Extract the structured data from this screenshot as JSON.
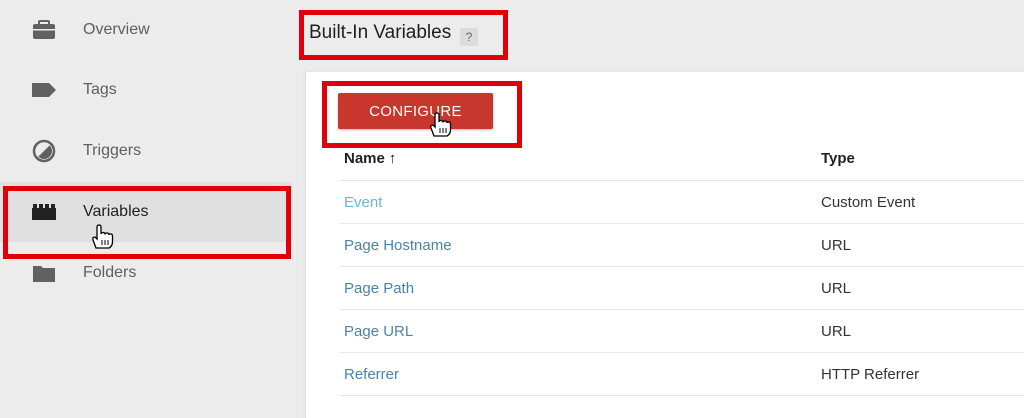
{
  "sidebar": {
    "items": [
      {
        "label": "Overview",
        "icon": "briefcase-icon"
      },
      {
        "label": "Tags",
        "icon": "tag-icon"
      },
      {
        "label": "Triggers",
        "icon": "trigger-icon"
      },
      {
        "label": "Variables",
        "icon": "variables-icon"
      },
      {
        "label": "Folders",
        "icon": "folder-icon"
      }
    ]
  },
  "header": {
    "title": "Built-In Variables",
    "help": "?"
  },
  "main": {
    "configure_label": "CONFIGURE",
    "columns": [
      "Name",
      "Type"
    ],
    "sort_indicator": "↑",
    "rows": [
      {
        "name": "Event",
        "type": "Custom Event"
      },
      {
        "name": "Page Hostname",
        "type": "URL"
      },
      {
        "name": "Page Path",
        "type": "URL"
      },
      {
        "name": "Page URL",
        "type": "URL"
      },
      {
        "name": "Referrer",
        "type": "HTTP Referrer"
      }
    ]
  },
  "colors": {
    "accent_red": "#c8372d",
    "annotation_red": "#e0000a",
    "link_blue": "#4d82ab"
  }
}
